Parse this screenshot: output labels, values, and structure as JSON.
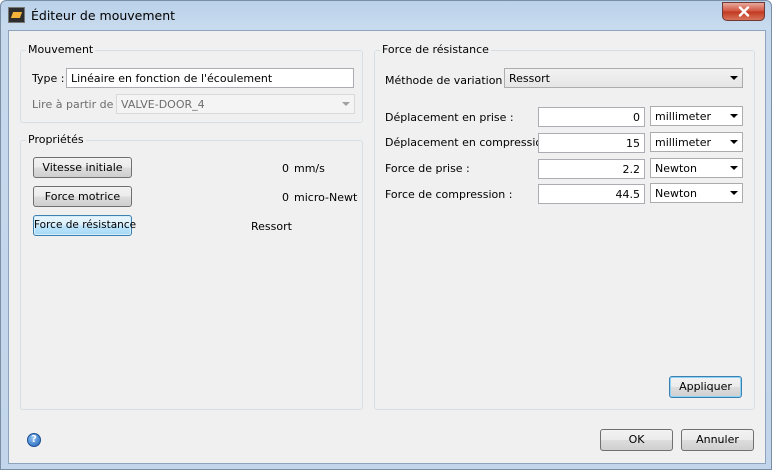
{
  "window": {
    "title": "Éditeur de mouvement"
  },
  "mouvement": {
    "legend": "Mouvement",
    "type_label": "Type :",
    "type_value": "Linéaire en fonction de l'écoulement",
    "read_from_label": "Lire à partir de :",
    "read_from_value": "VALVE-DOOR_4"
  },
  "proprietes": {
    "legend": "Propriétés",
    "rows": [
      {
        "button": "Vitesse initiale",
        "value": "0",
        "unit": "mm/s"
      },
      {
        "button": "Force motrice",
        "value": "0",
        "unit": "micro-Newto"
      },
      {
        "button": "Force de résistance",
        "value": "Ressort"
      }
    ]
  },
  "force": {
    "legend": "Force de résistance",
    "method_label": "Méthode de variation :",
    "method_value": "Ressort",
    "fields": [
      {
        "label": "Déplacement en prise :",
        "value": "0",
        "unit": "millimeter"
      },
      {
        "label": "Déplacement en compression :",
        "value": "15",
        "unit": "millimeter"
      },
      {
        "label": "Force de prise :",
        "value": "2.2",
        "unit": "Newton"
      },
      {
        "label": "Force de compression :",
        "value": "44.5",
        "unit": "Newton"
      }
    ],
    "apply_label": "Appliquer"
  },
  "footer": {
    "ok_label": "OK",
    "cancel_label": "Annuler",
    "help_icon": "?"
  },
  "icons": {
    "app": "motion-editor-app-icon",
    "close": "close-icon",
    "help": "help-icon"
  }
}
